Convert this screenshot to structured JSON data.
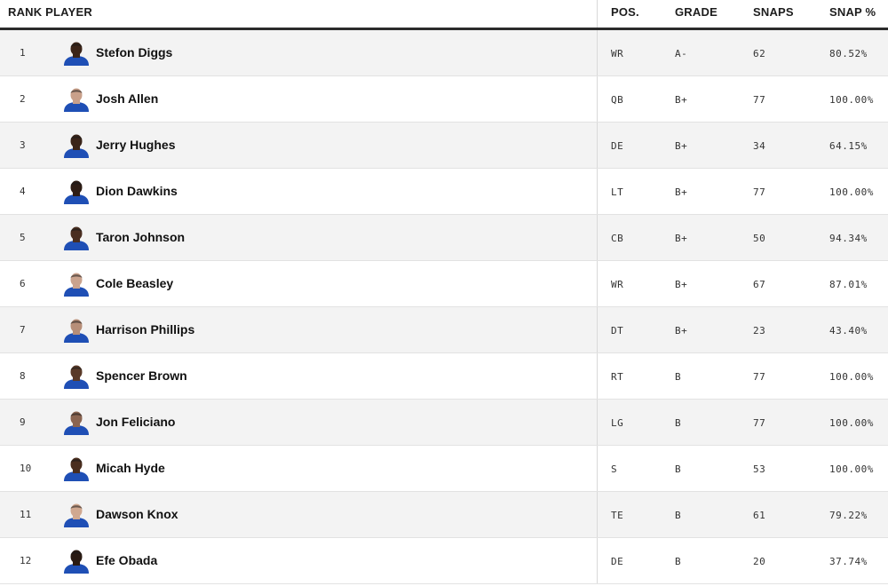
{
  "header": {
    "rank_player": "RANK PLAYER",
    "pos": "POS.",
    "grade": "GRADE",
    "snaps": "SNAPS",
    "snap_pct": "SNAP %"
  },
  "colors": {
    "jersey": "#1f4fb5",
    "header_rule": "#2b2b2b",
    "row_alt": "#f3f3f3"
  },
  "rows": [
    {
      "rank": "1",
      "name": "Stefon Diggs",
      "pos": "WR",
      "grade": "A-",
      "snaps": "62",
      "pct": "80.52%",
      "skin": "#3b2418"
    },
    {
      "rank": "2",
      "name": "Josh Allen",
      "pos": "QB",
      "grade": "B+",
      "snaps": "77",
      "pct": "100.00%",
      "skin": "#c9a08a"
    },
    {
      "rank": "3",
      "name": "Jerry Hughes",
      "pos": "DE",
      "grade": "B+",
      "snaps": "34",
      "pct": "64.15%",
      "skin": "#3a2419"
    },
    {
      "rank": "4",
      "name": "Dion Dawkins",
      "pos": "LT",
      "grade": "B+",
      "snaps": "77",
      "pct": "100.00%",
      "skin": "#2e1c14"
    },
    {
      "rank": "5",
      "name": "Taron Johnson",
      "pos": "CB",
      "grade": "B+",
      "snaps": "50",
      "pct": "94.34%",
      "skin": "#4a2e20"
    },
    {
      "rank": "6",
      "name": "Cole Beasley",
      "pos": "WR",
      "grade": "B+",
      "snaps": "67",
      "pct": "87.01%",
      "skin": "#caa38e"
    },
    {
      "rank": "7",
      "name": "Harrison Phillips",
      "pos": "DT",
      "grade": "B+",
      "snaps": "23",
      "pct": "43.40%",
      "skin": "#b78e78"
    },
    {
      "rank": "8",
      "name": "Spencer Brown",
      "pos": "RT",
      "grade": "B",
      "snaps": "77",
      "pct": "100.00%",
      "skin": "#5a3a28"
    },
    {
      "rank": "9",
      "name": "Jon Feliciano",
      "pos": "LG",
      "grade": "B",
      "snaps": "77",
      "pct": "100.00%",
      "skin": "#8a6450"
    },
    {
      "rank": "10",
      "name": "Micah Hyde",
      "pos": "S",
      "grade": "B",
      "snaps": "53",
      "pct": "100.00%",
      "skin": "#4a2e1f"
    },
    {
      "rank": "11",
      "name": "Dawson Knox",
      "pos": "TE",
      "grade": "B",
      "snaps": "61",
      "pct": "79.22%",
      "skin": "#d0a890"
    },
    {
      "rank": "12",
      "name": "Efe Obada",
      "pos": "DE",
      "grade": "B",
      "snaps": "20",
      "pct": "37.74%",
      "skin": "#2a1a12"
    }
  ]
}
